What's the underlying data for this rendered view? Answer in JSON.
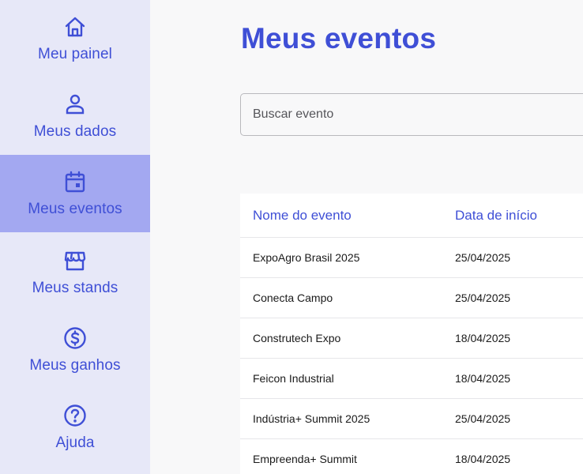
{
  "sidebar": {
    "items": [
      {
        "label": "Meu painel",
        "icon": "home-icon",
        "active": false
      },
      {
        "label": "Meus dados",
        "icon": "user-icon",
        "active": false
      },
      {
        "label": "Meus eventos",
        "icon": "calendar-icon",
        "active": true
      },
      {
        "label": "Meus stands",
        "icon": "storefront-icon",
        "active": false
      },
      {
        "label": "Meus ganhos",
        "icon": "dollar-circle-icon",
        "active": false
      },
      {
        "label": "Ajuda",
        "icon": "help-circle-icon",
        "active": false
      }
    ]
  },
  "main": {
    "title": "Meus eventos",
    "search": {
      "placeholder": "Buscar evento",
      "value": ""
    },
    "table": {
      "headers": [
        "Nome do evento",
        "Data de início"
      ],
      "rows": [
        [
          "ExpoAgro Brasil 2025",
          "25/04/2025"
        ],
        [
          "Conecta Campo",
          "25/04/2025"
        ],
        [
          "Construtech Expo",
          "18/04/2025"
        ],
        [
          "Feicon Industrial",
          "18/04/2025"
        ],
        [
          "Indústria+ Summit 2025",
          "25/04/2025"
        ],
        [
          "Empreenda+ Summit",
          "18/04/2025"
        ]
      ]
    }
  },
  "colors": {
    "accent": "#3f4fd6",
    "sidebar_bg": "#e7e8f8",
    "sidebar_active_bg": "#a3a8f1",
    "page_bg": "#f8f8f9"
  }
}
